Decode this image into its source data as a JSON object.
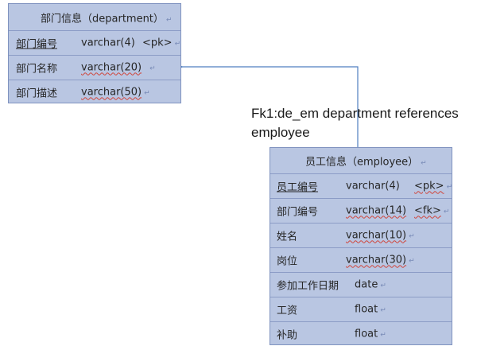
{
  "department": {
    "title": "部门信息（department）",
    "rows": [
      {
        "name": "部门编号",
        "type": "varchar(4)",
        "key": "<pk>"
      },
      {
        "name": "部门名称",
        "type": "varchar(20)",
        "key": ""
      },
      {
        "name": "部门描述",
        "type": "varchar(50)",
        "key": ""
      }
    ]
  },
  "relation": {
    "label": "Fk1:de_em  department references employee"
  },
  "employee": {
    "title": "员工信息（employee）",
    "rows": [
      {
        "name": "员工编号",
        "type": "varchar(4)",
        "key": "<pk>"
      },
      {
        "name": "部门编号",
        "type": "varchar(14)",
        "key": "<fk>"
      },
      {
        "name": "姓名",
        "type": "varchar(10)",
        "key": ""
      },
      {
        "name": "岗位",
        "type": "varchar(30)",
        "key": ""
      },
      {
        "name": "参加工作日期",
        "type": "date",
        "key": ""
      },
      {
        "name": "工资",
        "type": "float",
        "key": ""
      },
      {
        "name": "补助",
        "type": "float",
        "key": ""
      }
    ]
  },
  "colors": {
    "table_fill": "#b9c6e2",
    "table_border": "#7f92bf",
    "connector": "#4f7fc0"
  }
}
